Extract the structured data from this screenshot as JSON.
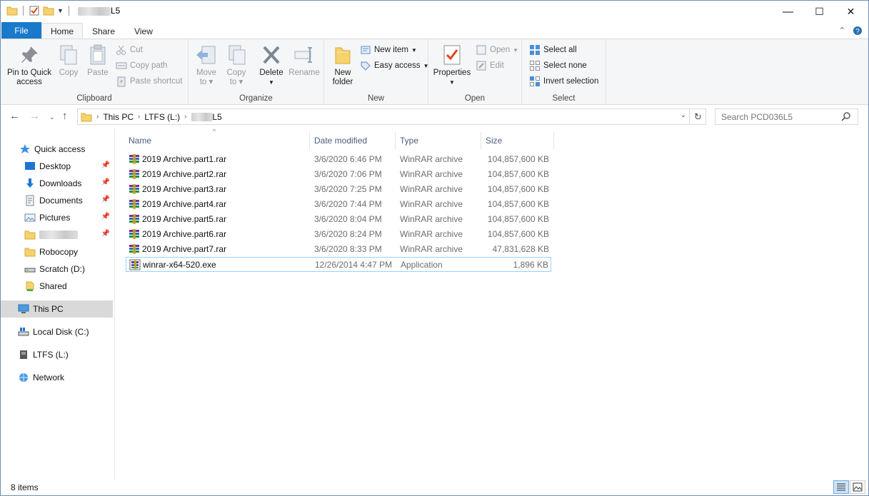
{
  "window": {
    "title_suffix": "L5",
    "minimize": "—",
    "maximize": "☐",
    "close": "✕"
  },
  "tabs": [
    "File",
    "Home",
    "Share",
    "View"
  ],
  "ribbon": {
    "clipboard": {
      "group": "Clipboard",
      "pin_line1": "Pin to Quick",
      "pin_line2": "access",
      "copy": "Copy",
      "paste": "Paste",
      "cut": "Cut",
      "copy_path": "Copy path",
      "paste_shortcut": "Paste shortcut"
    },
    "organize": {
      "group": "Organize",
      "move_line1": "Move",
      "move_line2": "to",
      "copy_line1": "Copy",
      "copy_line2": "to",
      "delete": "Delete",
      "rename": "Rename"
    },
    "new": {
      "group": "New",
      "new_folder_line1": "New",
      "new_folder_line2": "folder",
      "new_item": "New item",
      "easy_access": "Easy access"
    },
    "open": {
      "group": "Open",
      "properties": "Properties",
      "open": "Open",
      "edit": "Edit"
    },
    "select": {
      "group": "Select",
      "select_all": "Select all",
      "select_none": "Select none",
      "invert": "Invert selection"
    }
  },
  "address": {
    "crumbs": [
      "This PC",
      "LTFS (L:)",
      "L5"
    ],
    "search_placeholder": "Search PCD036L5"
  },
  "nav": {
    "quick_access": "Quick access",
    "desktop": "Desktop",
    "downloads": "Downloads",
    "documents": "Documents",
    "pictures": "Pictures",
    "robocopy": "Robocopy",
    "scratch": "Scratch (D:)",
    "shared": "Shared",
    "this_pc": "This PC",
    "local_disk": "Local Disk (C:)",
    "ltfs": "LTFS (L:)",
    "network": "Network"
  },
  "columns": {
    "name": "Name",
    "date": "Date modified",
    "type": "Type",
    "size": "Size"
  },
  "files": [
    {
      "name": "2019 Archive.part1.rar",
      "date": "3/6/2020 6:46 PM",
      "type": "WinRAR archive",
      "size": "104,857,600 KB"
    },
    {
      "name": "2019 Archive.part2.rar",
      "date": "3/6/2020 7:06 PM",
      "type": "WinRAR archive",
      "size": "104,857,600 KB"
    },
    {
      "name": "2019 Archive.part3.rar",
      "date": "3/6/2020 7:25 PM",
      "type": "WinRAR archive",
      "size": "104,857,600 KB"
    },
    {
      "name": "2019 Archive.part4.rar",
      "date": "3/6/2020 7:44 PM",
      "type": "WinRAR archive",
      "size": "104,857,600 KB"
    },
    {
      "name": "2019 Archive.part5.rar",
      "date": "3/6/2020 8:04 PM",
      "type": "WinRAR archive",
      "size": "104,857,600 KB"
    },
    {
      "name": "2019 Archive.part6.rar",
      "date": "3/6/2020 8:24 PM",
      "type": "WinRAR archive",
      "size": "104,857,600 KB"
    },
    {
      "name": "2019 Archive.part7.rar",
      "date": "3/6/2020 8:33 PM",
      "type": "WinRAR archive",
      "size": "47,831,628 KB"
    },
    {
      "name": "winrar-x64-520.exe",
      "date": "12/26/2014 4:47 PM",
      "type": "Application",
      "size": "1,896 KB"
    }
  ],
  "status": {
    "count": "8 items"
  },
  "colors": {
    "file_tab": "#1979ca",
    "ribbon_bg": "#f5f6f7",
    "selection_border": "#99d1ff",
    "nav_selected": "#d9d9d9"
  }
}
